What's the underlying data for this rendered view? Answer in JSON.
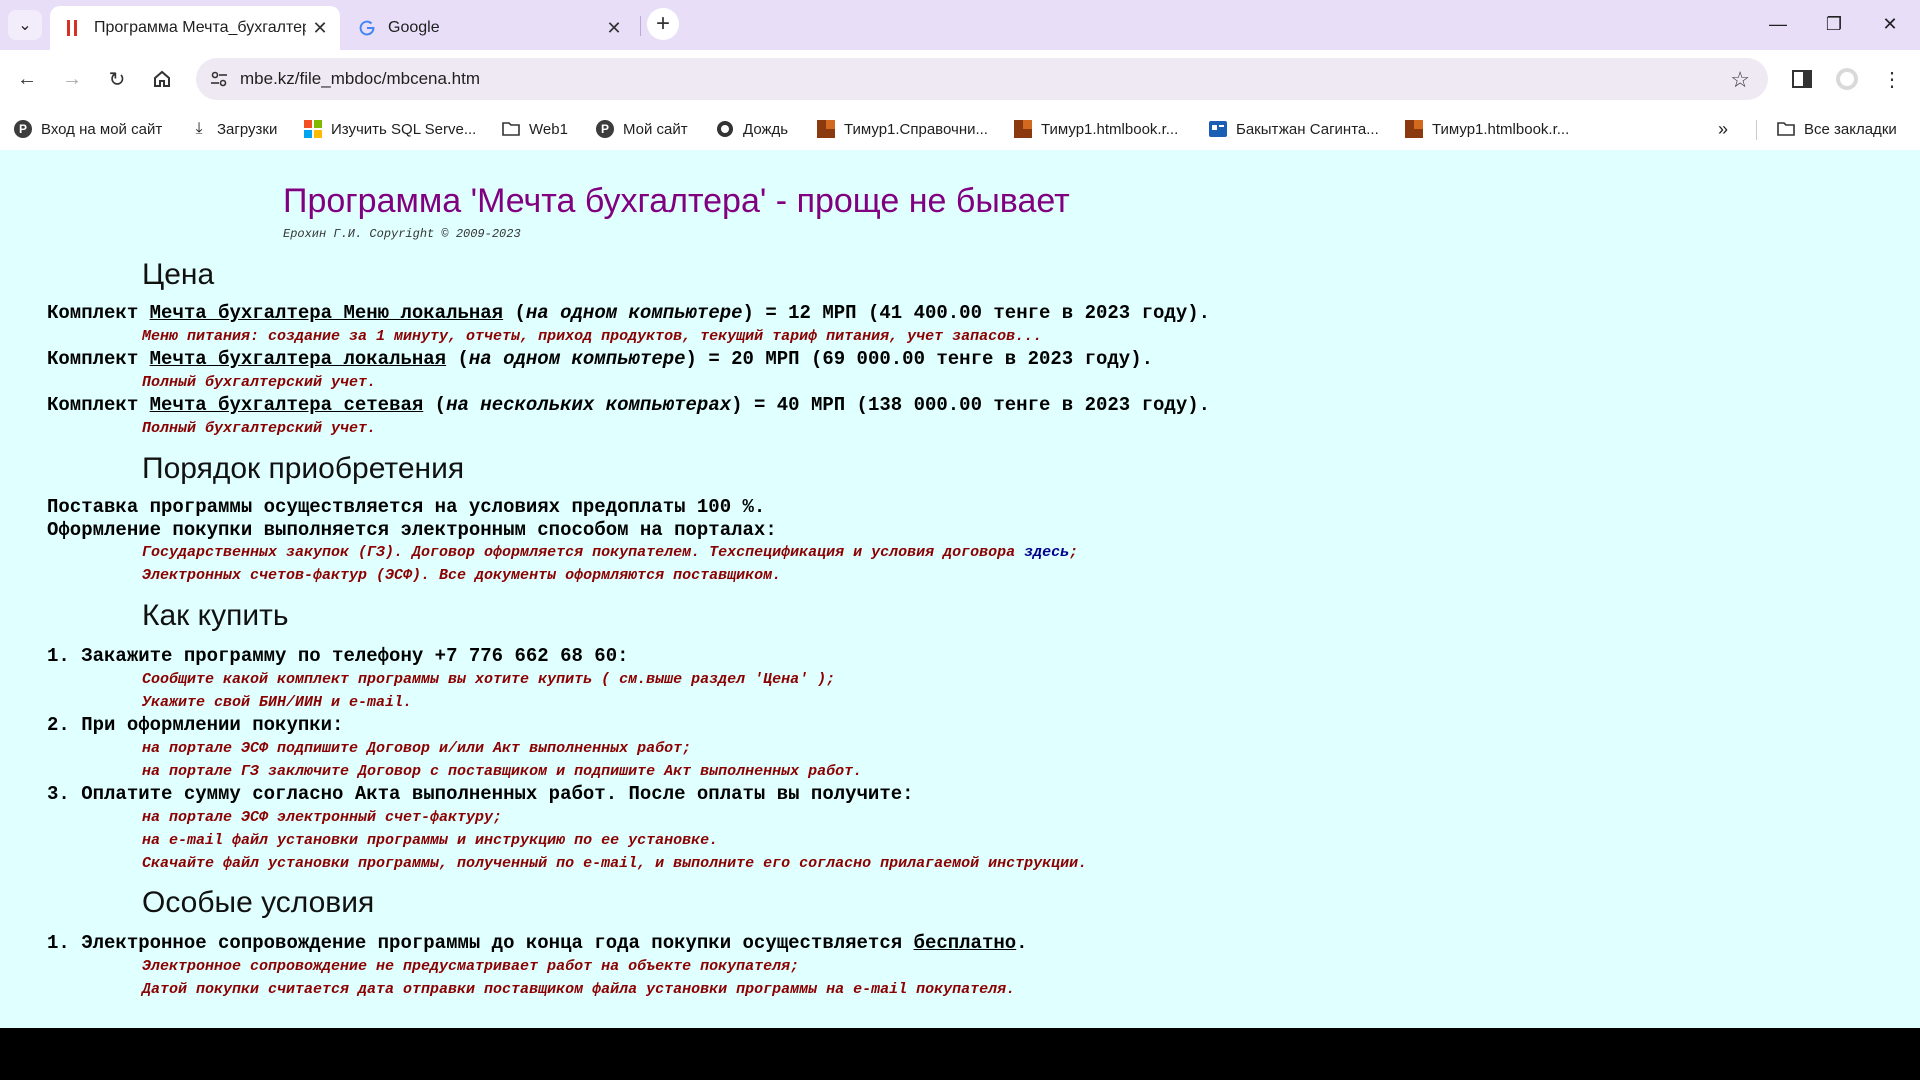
{
  "browser": {
    "tabs": [
      {
        "title": "Программа Мечта_бухгалтер",
        "active": true
      },
      {
        "title": "Google",
        "active": false
      }
    ],
    "url": "mbe.kz/file_mbdoc/mbcena.htm",
    "bookmarks": [
      {
        "label": "Вход на мой сайт",
        "icon": "p-icon"
      },
      {
        "label": "Загрузки",
        "icon": "download-icon"
      },
      {
        "label": "Изучить SQL Serve...",
        "icon": "microsoft-icon"
      },
      {
        "label": "Web1",
        "icon": "folder-icon"
      },
      {
        "label": "Мой сайт",
        "icon": "p-icon"
      },
      {
        "label": "Дождь",
        "icon": "globe-icon"
      },
      {
        "label": "Тимур1.Справочни...",
        "icon": "brick-icon"
      },
      {
        "label": "Тимур1.htmlbook.r...",
        "icon": "brick-icon"
      },
      {
        "label": "Бакытжан Сагинта...",
        "icon": "profile-card-icon"
      },
      {
        "label": "Тимур1.htmlbook.r...",
        "icon": "brick-icon"
      }
    ],
    "all_bookmarks": "Все закладки"
  },
  "page": {
    "title": "Программа 'Мечта бухгалтера' - проще не бывает",
    "copyright": "Ерохин Г.И. Copyright © 2009-2023",
    "price": {
      "heading": "Цена",
      "items": [
        {
          "pre": "Комплект ",
          "link": "Мечта бухгалтера Меню локальная",
          "mid_open": " (",
          "note": "на одном компьютере",
          "post": ") = 12 МРП (41 400.00 тенге в 2023 году).",
          "desc": "Меню питания: создание за 1 минуту, отчеты, приход продуктов, текущий тариф питания, учет запасов..."
        },
        {
          "pre": "Комплект ",
          "link": "Мечта бухгалтера локальная",
          "mid_open": " (",
          "note": "на одном компьютере",
          "post": ") = 20 МРП (69 000.00 тенге в 2023 году).",
          "desc": "Полный бухгалтерский учет."
        },
        {
          "pre": "Комплект ",
          "link": "Мечта бухгалтера сетевая",
          "mid_open": " (",
          "note": "на нескольких компьютерах",
          "post": ") = 40 МРП (138 000.00 тенге в 2023 году).",
          "desc": "Полный бухгалтерский учет."
        }
      ]
    },
    "order": {
      "heading": "Порядок приобретения",
      "line1": "Поставка программы осуществляется на условиях предоплаты 100 %.",
      "line2": "Оформление покупки выполняется электронным способом на порталах:",
      "sub1_text": "Государственных закупок (ГЗ). Договор оформляется покупателем. Техспецификация и условия договора ",
      "sub1_link": "здесь",
      "sub1_end": ";",
      "sub2": "Электронных счетов-фактур (ЭСФ). Все документы оформляются поставщиком."
    },
    "howto": {
      "heading": "Как купить",
      "step1": "1. Закажите программу по телефону +7 776 662 68 60:",
      "step1_sub1": "Сообщите какой комплект программы вы хотите купить ( см.выше раздел 'Цена' );",
      "step1_sub2": "Укажите свой БИН/ИИН и e-mail.",
      "step2": "2. При оформлении покупки:",
      "step2_sub1": "на портале ЭСФ подпишите Договор и/или Акт выполненных работ;",
      "step2_sub2": "на портале ГЗ заключите Договор с поставщиком и подпишите Акт выполненных работ.",
      "step3": "3. Оплатите сумму согласно Акта выполненных работ. После оплаты вы получите:",
      "step3_sub1": "на портале ЭСФ электронный счет-фактуру;",
      "step3_sub2": "на e-mail файл установки программы и инструкцию по ее установке.",
      "step3_sub3": "Скачайте файл установки программы, полученный по e-mail, и выполните его согласно прилагаемой инструкции."
    },
    "special": {
      "heading": "Особые условия",
      "item1_pre": "1. Электронное сопровождение программы до конца года покупки осуществляется ",
      "item1_link": "бесплатно",
      "item1_post": ".",
      "sub1": "Электронное сопровождение не предусматривает работ на объекте покупателя;",
      "sub2": "Датой покупки считается дата отправки поставщиком файла установки программы на e-mail покупателя."
    }
  }
}
